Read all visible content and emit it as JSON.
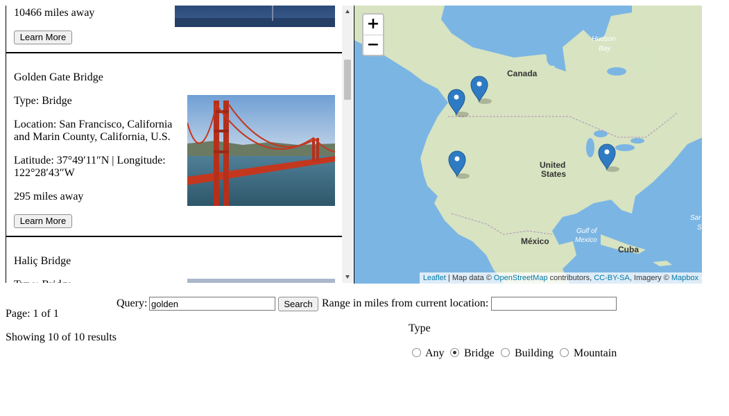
{
  "results": [
    {
      "distance": "10466 miles away",
      "learn_more": "Learn More"
    },
    {
      "name": "Golden Gate Bridge",
      "type": "Type: Bridge",
      "location": [
        "Location: San Francisco, California",
        "and Marin County, California, U.S."
      ],
      "coords": [
        "Latitude: 37°49′11″N | Longitude:",
        "122°28′43″W"
      ],
      "distance": "295 miles away",
      "learn_more": "Learn More"
    },
    {
      "name": "Haliç Bridge",
      "type": "Type: Bridge"
    }
  ],
  "map": {
    "zoom_in": "+",
    "zoom_out": "−",
    "labels": {
      "canada": "Canada",
      "hudson": [
        "Hudson",
        "Bay"
      ],
      "united_states": [
        "United",
        "States"
      ],
      "mexico": "México",
      "gulf": [
        "Gulf of",
        "Mexico"
      ],
      "cuba": "Cuba",
      "sargasso": [
        "Sar",
        "S"
      ]
    },
    "attribution": {
      "leaflet": "Leaflet",
      "sep1": " | Map data © ",
      "osm": "OpenStreetMap",
      "mid": " contributors, ",
      "license": "CC-BY-SA",
      "mid2": ", Imagery © ",
      "mapbox": "Mapbox"
    },
    "marker_color": "#2e7bc4",
    "water_color": "#7bb5e3",
    "land_color": "#d7e3c1"
  },
  "search": {
    "query_label": "Query:",
    "query_value": "golden",
    "button": "Search",
    "range_label": "Range in miles from current location:",
    "range_value": ""
  },
  "pager": {
    "page": "Page: 1 of 1",
    "showing": "Showing 10 of 10 results"
  },
  "type_filter": {
    "heading": "Type",
    "options": [
      "Any",
      "Bridge",
      "Building",
      "Mountain"
    ],
    "selected": "Bridge"
  }
}
